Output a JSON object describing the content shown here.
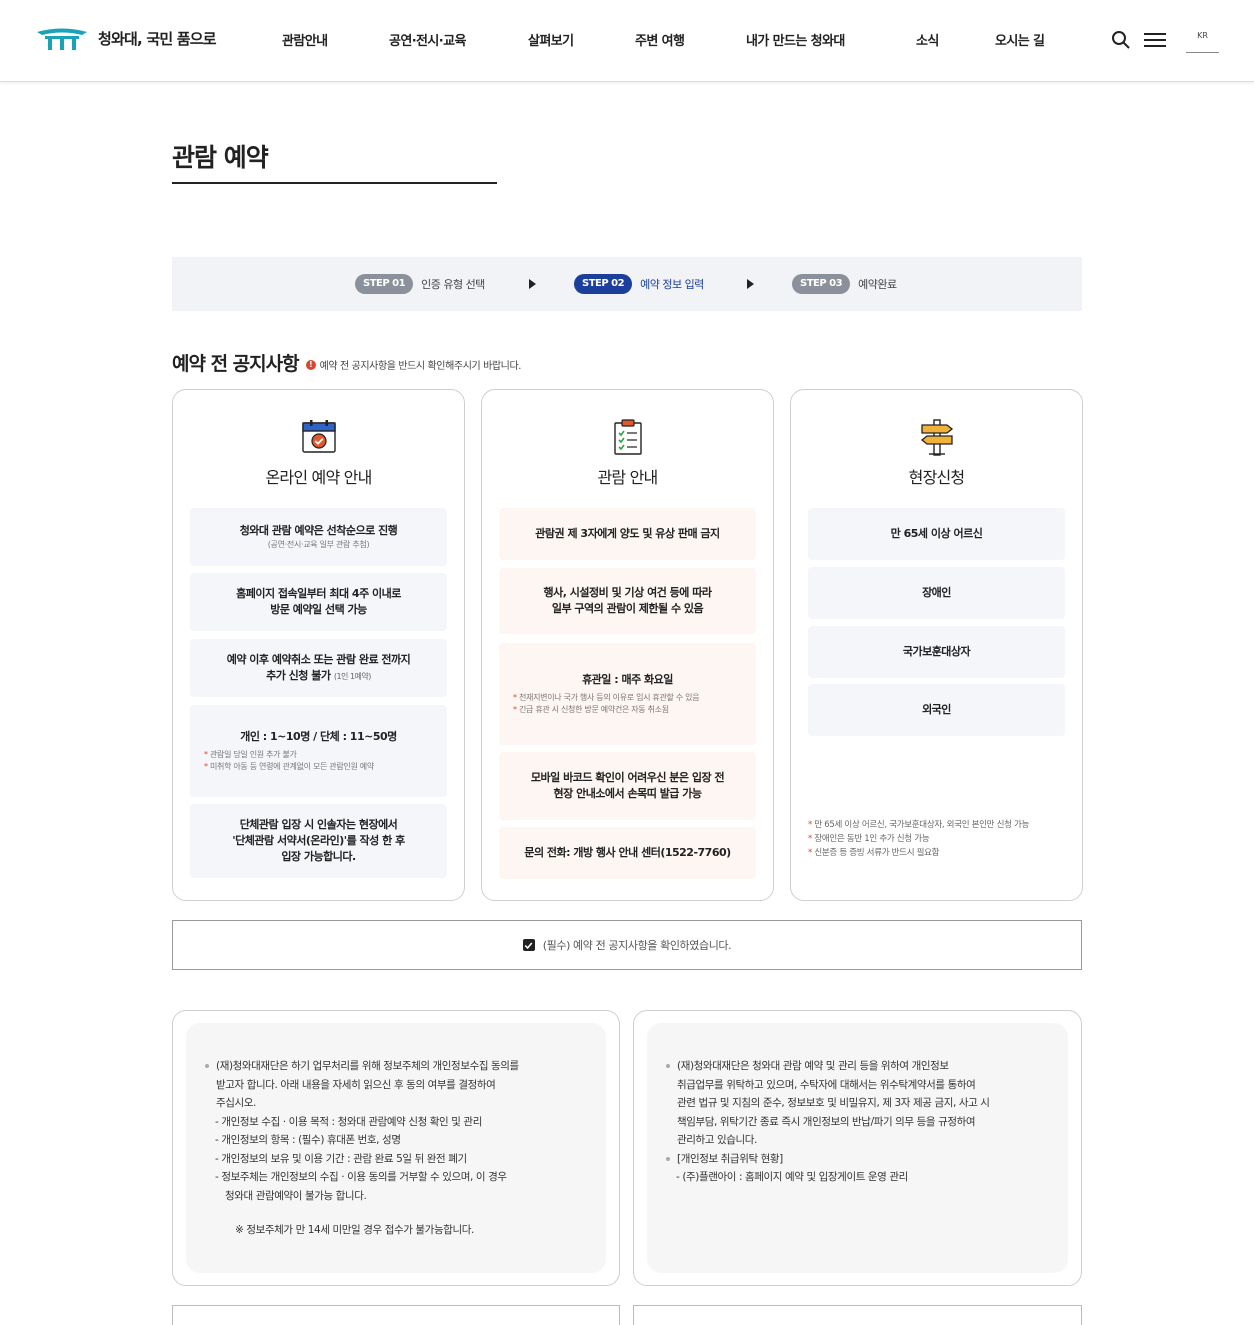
{
  "header": {
    "logo_text": "청와대, 국민 품으로",
    "nav": [
      "관람안내",
      "공연·전시·교육",
      "살펴보기",
      "주변 여행",
      "내가 만드는 청와대",
      "소식",
      "오시는 길"
    ],
    "lang": "KR",
    "icons": [
      "search-icon",
      "menu-icon"
    ]
  },
  "page": {
    "title": "관람 예약"
  },
  "steps": [
    {
      "badge": "STEP 01",
      "label": "인증 유형 선택",
      "active": false
    },
    {
      "badge": "STEP 02",
      "label": "예약 정보 입력",
      "active": true
    },
    {
      "badge": "STEP 03",
      "label": "예약완료",
      "active": false
    }
  ],
  "notice": {
    "heading": "예약 전 공지사항",
    "info_glyph": "!",
    "subtext": "예약 전 공지사항을 반드시 확인해주시기 바랍니다."
  },
  "cards": [
    {
      "icon": "calendar-check-icon",
      "title": "온라인 예약 안내",
      "items": [
        {
          "main": "청와대 관람 예약은 선착순으로 진행",
          "sub": "(공연·전시·교육 일부 관람 추첨)"
        },
        {
          "main1": "홈페이지 접속일부터 최대 4주 이내로",
          "main2": "방문 예약일 선택 가능"
        },
        {
          "main1": "예약 이후 예약취소 또는 관람 완료 전까지",
          "main2": "추가 신청 불가",
          "small": "(1인 1예약)"
        },
        {
          "main": "개인 : 1~10명 / 단체 : 11~50명",
          "notes": [
            "관람일 당일 인원 추가 불가",
            "미취학 아동 등 연령에 관계없이 모든 관람인원 예약"
          ]
        },
        {
          "main1": "단체관람 입장 시 인솔자는 현장에서",
          "main2": "'단체관람 서약서(온라인)'를 작성 한 후",
          "main3": "입장 가능합니다."
        }
      ]
    },
    {
      "icon": "clipboard-check-icon",
      "title": "관람 안내",
      "items": [
        {
          "main": "관람권 제 3자에게 양도 및 유상 판매 금지"
        },
        {
          "main1": "행사, 시설정비 및 기상 여건 등에 따라",
          "main2": "일부 구역의 관람이 제한될 수 있음"
        },
        {
          "main": "휴관일 : 매주 화요일",
          "notes": [
            "천재지변이나 국가 행사 등의 이유로 임시 휴관할 수 있음",
            "긴급 휴관 시 신청한 방문 예약건은 자동 취소됨"
          ]
        },
        {
          "main1": "모바일 바코드 확인이 어려우신 분은 입장 전",
          "main2": "현장 안내소에서 손목띠 발급 가능"
        },
        {
          "main": "문의 전화: 개방 행사 안내 센터(1522-7760)"
        }
      ]
    },
    {
      "icon": "signpost-icon",
      "title": "현장신청",
      "items": [
        "만 65세 이상 어르신",
        "장애인",
        "국가보훈대상자",
        "외국인"
      ],
      "notes": [
        "만 65세 이상 어르신, 국가보훈대상자, 외국인 본인만 신청 가능",
        "장애인은 동반 1인 추가 신청 가능",
        "신분증 등 증빙 서류가 반드시 필요함"
      ]
    }
  ],
  "confirm": {
    "label": "(필수) 예약 전 공지사항을 확인하였습니다.",
    "checked": true
  },
  "privacy_left": {
    "intro": [
      "(재)청와대재단은 하기 업무처리를 위해 정보주체의 개인정보수집 동의를",
      "받고자 합니다. 아래 내용을 자세히 읽으신 후 동의 여부를 결정하여",
      "주십시오."
    ],
    "items": [
      "- 개인정보 수집 · 이용 목적 : 청와대 관람예약 신청 확인 및 관리",
      "- 개인정보의 항목 : (필수) 휴대폰 번호, 성명",
      "- 개인정보의 보유 및 이용 기간 : 관람 완료 5일 뒤 완전 폐기",
      "- 정보주체는 개인정보의 수집 · 이용 동의를 거부할 수 있으며, 이 경우",
      "청와대 관람예약이 불가능 합니다."
    ],
    "note": "※ 정보주체가 만 14세 미만일 경우 접수가 불가능합니다."
  },
  "privacy_right": {
    "intro": [
      "(재)청와대재단은 청와대 관람 예약 및 관리 등을 위하여 개인정보",
      "취급업무를 위탁하고 있으며, 수탁자에 대해서는 위수탁계약서를 통하여",
      "관련 법규 및 지침의 준수, 정보보호 및 비밀유지, 제 3자 제공 금지, 사고 시",
      "책임부담, 위탁기간 종료 즉시 개인정보의 반납/파기 의무 등을 규정하여",
      "관리하고 있습니다."
    ],
    "heading": "[개인정보 취급위탁 현황]",
    "item": "- (주)플랜아이 : 홈페이지 예약 및 입장게이트 운영 관리"
  },
  "colors": {
    "accent": "#1b3f9a",
    "step_inactive": "#8b919b",
    "logo_teal": "#19a3b8",
    "alert": "#d9482a"
  }
}
